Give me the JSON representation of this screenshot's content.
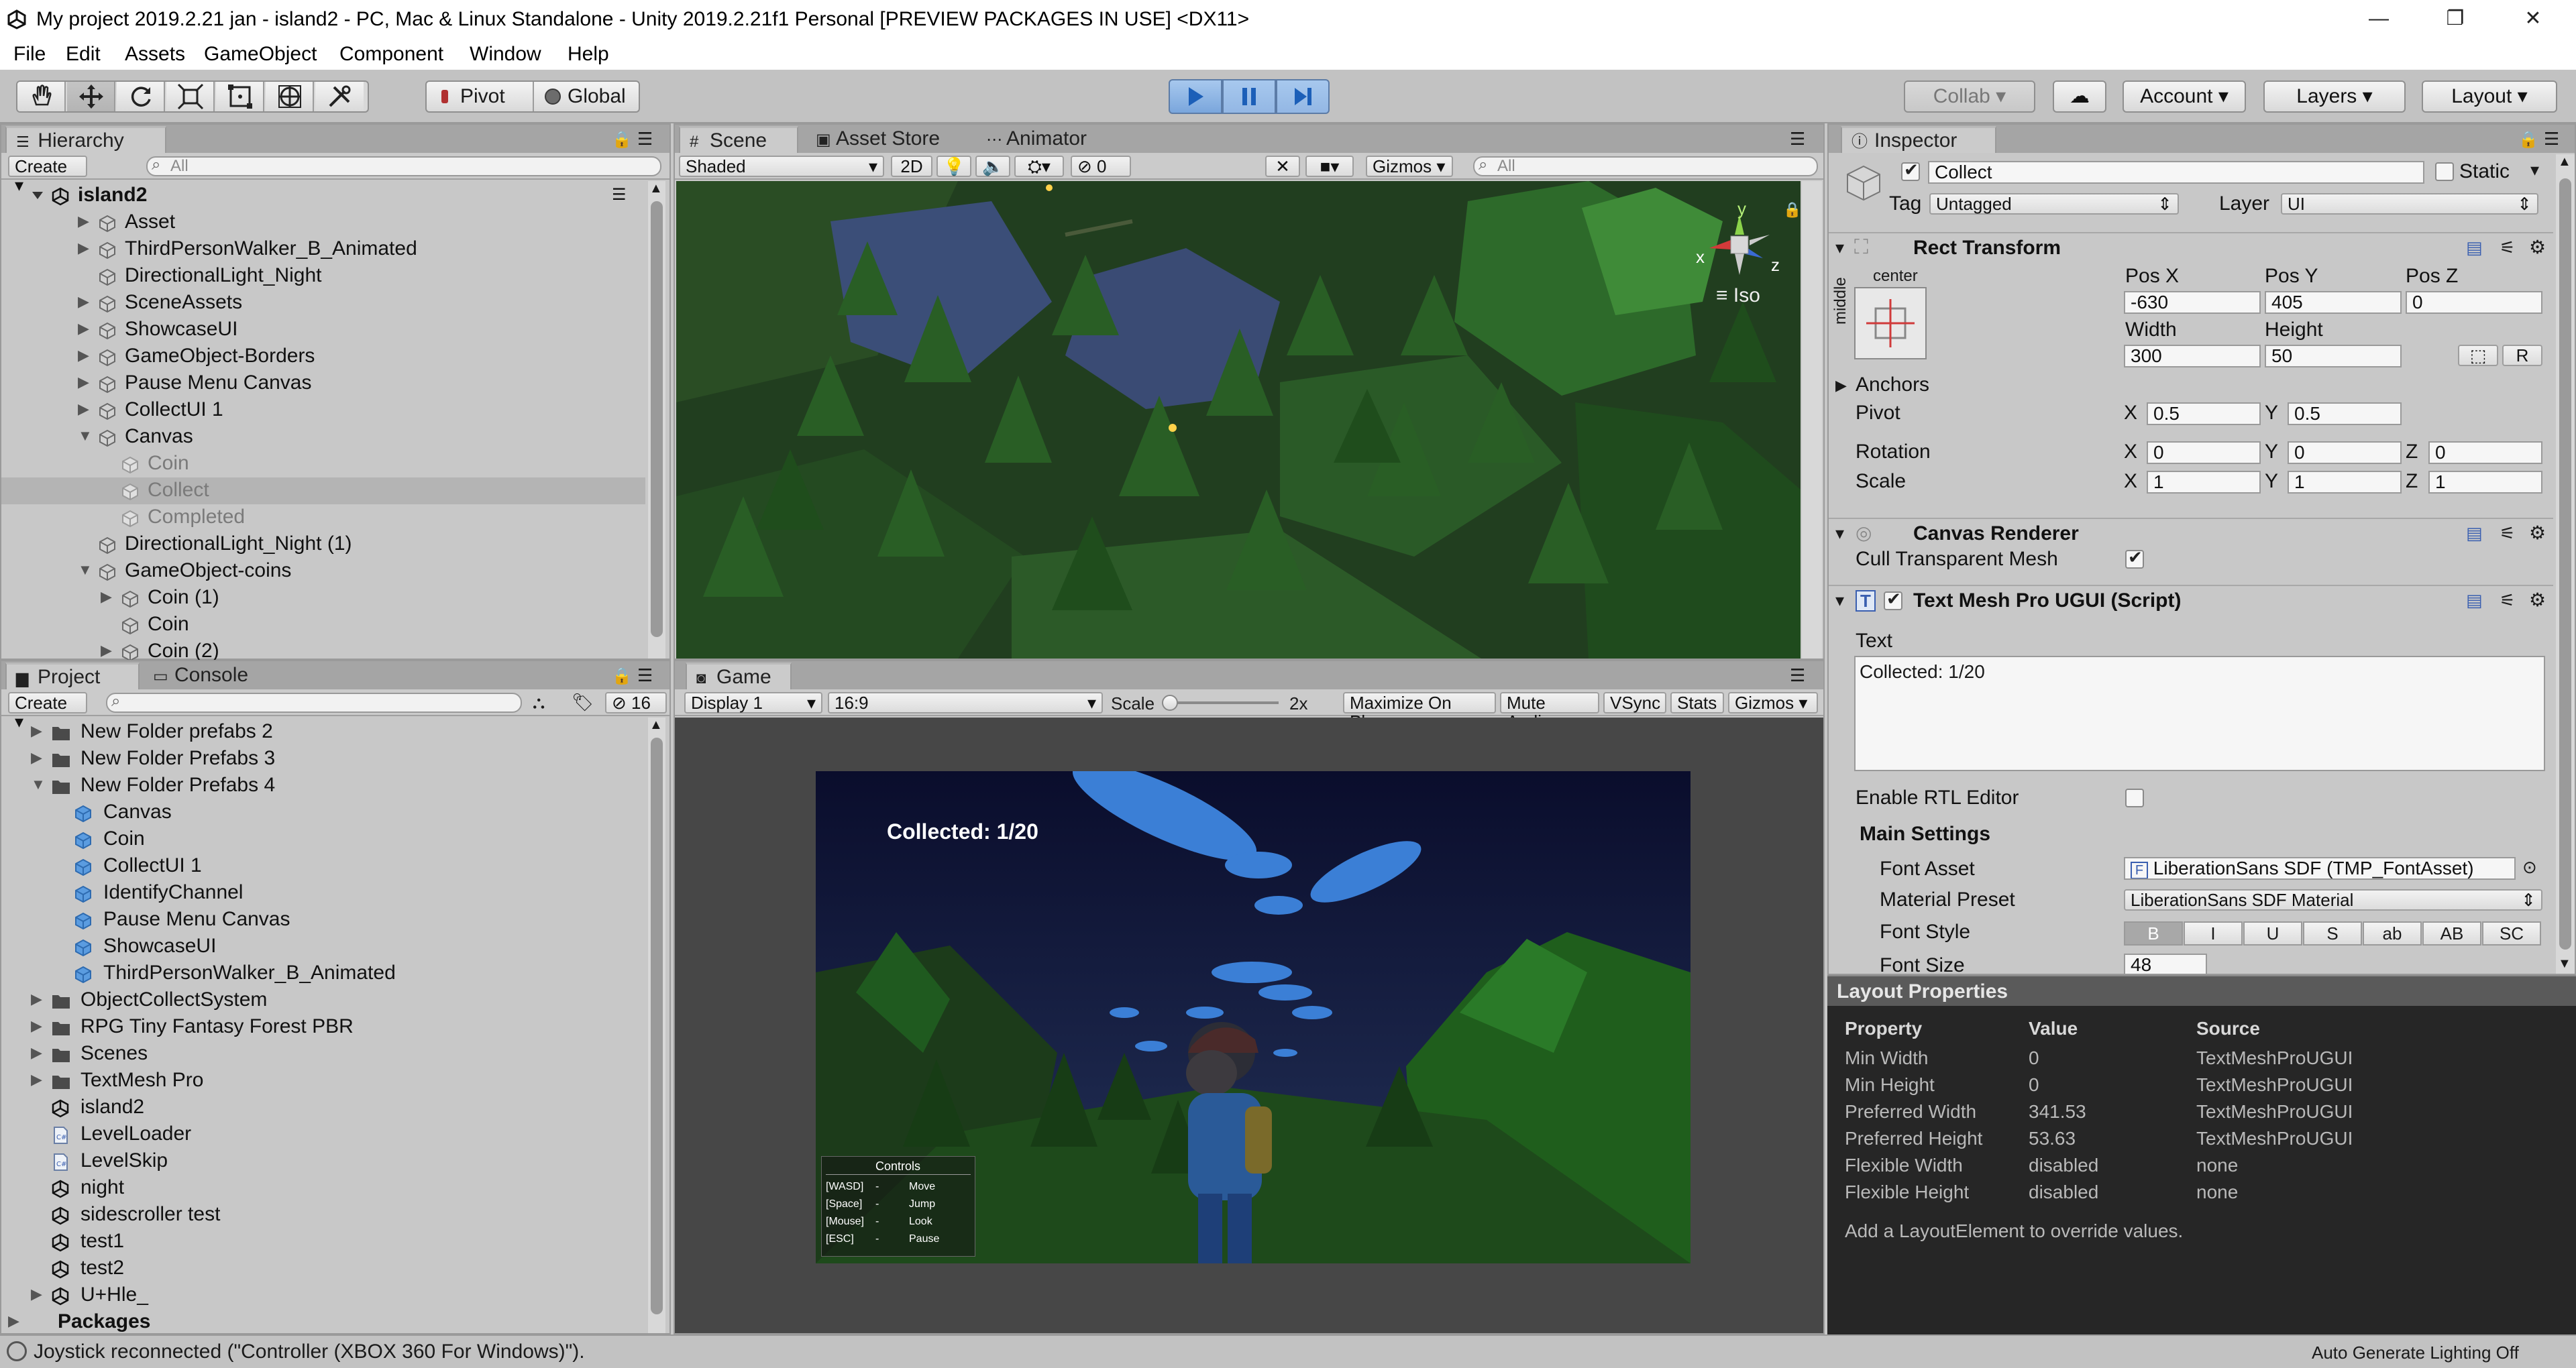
{
  "window": {
    "title": "My project 2019.2.21 jan - island2 - PC, Mac & Linux Standalone - Unity 2019.2.21f1 Personal [PREVIEW PACKAGES IN USE] <DX11>"
  },
  "menu": [
    "File",
    "Edit",
    "Assets",
    "GameObject",
    "Component",
    "Window",
    "Help"
  ],
  "toolbar": {
    "pivot_label": "Pivot",
    "global_label": "Global",
    "collab_label": "Collab",
    "account_label": "Account",
    "layers_label": "Layers",
    "layout_label": "Layout",
    "tools": [
      "hand-tool-icon",
      "move-tool-icon",
      "rotate-tool-icon",
      "scale-tool-icon",
      "rect-tool-icon",
      "transform-tool-icon",
      "custom-tool-icon"
    ]
  },
  "hierarchy": {
    "tab_label": "Hierarchy",
    "create_label": "Create",
    "search_placeholder": "All",
    "scene_name": "island2",
    "items": [
      {
        "label": "Asset",
        "indent": 1,
        "arrow": "right",
        "dim": false,
        "selected": false
      },
      {
        "label": "ThirdPersonWalker_B_Animated",
        "indent": 1,
        "arrow": "right",
        "dim": false,
        "selected": false
      },
      {
        "label": "DirectionalLight_Night",
        "indent": 1,
        "arrow": "",
        "dim": false,
        "selected": false
      },
      {
        "label": "SceneAssets",
        "indent": 1,
        "arrow": "right",
        "dim": false,
        "selected": false
      },
      {
        "label": "ShowcaseUI",
        "indent": 1,
        "arrow": "right",
        "dim": false,
        "selected": false
      },
      {
        "label": "GameObject-Borders",
        "indent": 1,
        "arrow": "right",
        "dim": false,
        "selected": false
      },
      {
        "label": "Pause Menu Canvas",
        "indent": 1,
        "arrow": "right",
        "dim": false,
        "selected": false
      },
      {
        "label": "CollectUI 1",
        "indent": 1,
        "arrow": "right",
        "dim": false,
        "selected": false
      },
      {
        "label": "Canvas",
        "indent": 1,
        "arrow": "down",
        "dim": false,
        "selected": false
      },
      {
        "label": "Coin",
        "indent": 2,
        "arrow": "",
        "dim": true,
        "selected": false
      },
      {
        "label": "Collect",
        "indent": 2,
        "arrow": "",
        "dim": true,
        "selected": true
      },
      {
        "label": "Completed",
        "indent": 2,
        "arrow": "",
        "dim": true,
        "selected": false
      },
      {
        "label": "DirectionalLight_Night (1)",
        "indent": 1,
        "arrow": "",
        "dim": false,
        "selected": false
      },
      {
        "label": "GameObject-coins",
        "indent": 1,
        "arrow": "down",
        "dim": false,
        "selected": false
      },
      {
        "label": "Coin (1)",
        "indent": 2,
        "arrow": "right",
        "dim": false,
        "selected": false
      },
      {
        "label": "Coin",
        "indent": 2,
        "arrow": "",
        "dim": false,
        "selected": false
      },
      {
        "label": "Coin (2)",
        "indent": 2,
        "arrow": "right",
        "dim": false,
        "selected": false
      }
    ]
  },
  "scene_view": {
    "tabs": [
      "Scene",
      "Asset Store",
      "Animator"
    ],
    "shading": "Shaded",
    "mode_2d": "2D",
    "hidden_count": "0",
    "gizmos_label": "Gizmos",
    "search_placeholder": "All",
    "iso_label": "Iso",
    "axis_y": "y",
    "axis_x": "x",
    "axis_z": "z"
  },
  "project": {
    "tabs": [
      "Project",
      "Console"
    ],
    "create_label": "Create",
    "hidden_count": "16",
    "items": [
      {
        "label": "New Folder prefabs 2",
        "indent": 0,
        "arrow": "right",
        "kind": "folder"
      },
      {
        "label": "New Folder Prefabs 3",
        "indent": 0,
        "arrow": "right",
        "kind": "folder"
      },
      {
        "label": "New Folder Prefabs 4",
        "indent": 0,
        "arrow": "down",
        "kind": "folder"
      },
      {
        "label": "Canvas",
        "indent": 1,
        "arrow": "",
        "kind": "prefab"
      },
      {
        "label": "Coin",
        "indent": 1,
        "arrow": "",
        "kind": "prefab"
      },
      {
        "label": "CollectUI 1",
        "indent": 1,
        "arrow": "",
        "kind": "prefab"
      },
      {
        "label": "IdentifyChannel",
        "indent": 1,
        "arrow": "",
        "kind": "prefab"
      },
      {
        "label": "Pause Menu Canvas",
        "indent": 1,
        "arrow": "",
        "kind": "prefab"
      },
      {
        "label": "ShowcaseUI",
        "indent": 1,
        "arrow": "",
        "kind": "prefab"
      },
      {
        "label": "ThirdPersonWalker_B_Animated",
        "indent": 1,
        "arrow": "",
        "kind": "prefab"
      },
      {
        "label": "ObjectCollectSystem",
        "indent": 0,
        "arrow": "right",
        "kind": "folder"
      },
      {
        "label": "RPG Tiny Fantasy Forest PBR",
        "indent": 0,
        "arrow": "right",
        "kind": "folder"
      },
      {
        "label": "Scenes",
        "indent": 0,
        "arrow": "right",
        "kind": "folder"
      },
      {
        "label": "TextMesh Pro",
        "indent": 0,
        "arrow": "right",
        "kind": "folder"
      },
      {
        "label": "island2",
        "indent": 0,
        "arrow": "",
        "kind": "unity"
      },
      {
        "label": "LevelLoader",
        "indent": 0,
        "arrow": "",
        "kind": "script"
      },
      {
        "label": "LevelSkip",
        "indent": 0,
        "arrow": "",
        "kind": "script"
      },
      {
        "label": "night",
        "indent": 0,
        "arrow": "",
        "kind": "unity"
      },
      {
        "label": "sidescroller test",
        "indent": 0,
        "arrow": "",
        "kind": "unity"
      },
      {
        "label": "test1",
        "indent": 0,
        "arrow": "",
        "kind": "unity"
      },
      {
        "label": "test2",
        "indent": 0,
        "arrow": "",
        "kind": "unity"
      },
      {
        "label": "U+Hle_",
        "indent": 0,
        "arrow": "right",
        "kind": "unity"
      },
      {
        "label": "Packages",
        "indent": -1,
        "arrow": "right",
        "kind": "root"
      }
    ]
  },
  "game_view": {
    "tab_label": "Game",
    "display": "Display 1",
    "aspect": "16:9",
    "scale_label": "Scale",
    "scale_value": "2x",
    "buttons": [
      "Maximize On Play",
      "Mute Audio",
      "VSync",
      "Stats",
      "Gizmos"
    ],
    "hud_text": "Collected: 1/20",
    "controls_title": "Controls",
    "controls": [
      {
        "key": "[WASD]",
        "action": "Move"
      },
      {
        "key": "[Space]",
        "action": "Jump"
      },
      {
        "key": "[Mouse]",
        "action": "Look"
      },
      {
        "key": "[ESC]",
        "action": "Pause"
      }
    ]
  },
  "inspector": {
    "tab_label": "Inspector",
    "object_name": "Collect",
    "static_label": "Static",
    "tag_label": "Tag",
    "tag_value": "Untagged",
    "layer_label": "Layer",
    "layer_value": "UI",
    "rect_transform": {
      "title": "Rect Transform",
      "anchor_h": "center",
      "anchor_v": "middle",
      "pos_x_label": "Pos X",
      "pos_x": "-630",
      "pos_y_label": "Pos Y",
      "pos_y": "405",
      "pos_z_label": "Pos Z",
      "pos_z": "0",
      "width_label": "Width",
      "width": "300",
      "height_label": "Height",
      "height": "50",
      "r_btn": "R",
      "anchors_label": "Anchors",
      "pivot_label": "Pivot",
      "pivot_x": "0.5",
      "pivot_y": "0.5",
      "rotation_label": "Rotation",
      "rot_x": "0",
      "rot_y": "0",
      "rot_z": "0",
      "scale_label": "Scale",
      "scale_x": "1",
      "scale_y": "1",
      "scale_z": "1",
      "x": "X",
      "y": "Y",
      "z": "Z"
    },
    "canvas_renderer": {
      "title": "Canvas Renderer",
      "cull_label": "Cull Transparent Mesh",
      "cull_value": true
    },
    "tmp": {
      "title": "Text Mesh Pro UGUI (Script)",
      "text_label": "Text",
      "text_value": "Collected: 1/20",
      "rtl_label": "Enable RTL Editor",
      "main_settings": "Main Settings",
      "font_asset_label": "Font Asset",
      "font_asset_value": "LiberationSans SDF (TMP_FontAsset)",
      "material_label": "Material Preset",
      "material_value": "LiberationSans SDF Material",
      "font_style_label": "Font Style",
      "font_styles": [
        "B",
        "I",
        "U",
        "S",
        "ab",
        "AB",
        "SC"
      ],
      "font_size_label": "Font Size",
      "font_size_value": "48"
    },
    "layout_properties": {
      "title": "Layout Properties",
      "headers": [
        "Property",
        "Value",
        "Source"
      ],
      "rows": [
        [
          "Min Width",
          "0",
          "TextMeshProUGUI"
        ],
        [
          "Min Height",
          "0",
          "TextMeshProUGUI"
        ],
        [
          "Preferred Width",
          "341.53",
          "TextMeshProUGUI"
        ],
        [
          "Preferred Height",
          "53.63",
          "TextMeshProUGUI"
        ],
        [
          "Flexible Width",
          "disabled",
          "none"
        ],
        [
          "Flexible Height",
          "disabled",
          "none"
        ]
      ],
      "hint": "Add a LayoutElement to override values."
    }
  },
  "status": {
    "message": "Joystick reconnected (\"Controller (XBOX 360 For Windows)\").",
    "lighting": "Auto Generate Lighting Off"
  },
  "colors": {
    "play_active": "#7aa6dc",
    "selection": "#b4b4b4",
    "layout_bg": "#262626"
  }
}
